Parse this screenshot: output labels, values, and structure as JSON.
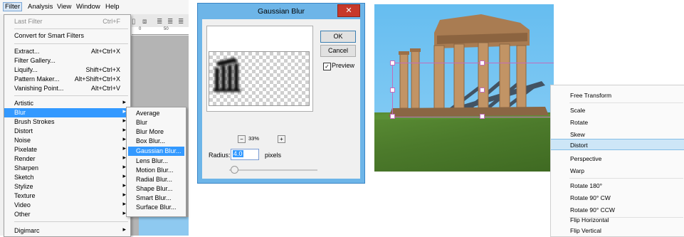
{
  "menubar": {
    "items": [
      "Filter",
      "Analysis",
      "View",
      "Window",
      "Help"
    ]
  },
  "filter_menu": {
    "items": [
      {
        "label": "Last Filter",
        "shortcut": "Ctrl+F",
        "disabled": true
      },
      {
        "label": "Convert for Smart Filters"
      },
      {
        "label": "Extract...",
        "shortcut": "Alt+Ctrl+X"
      },
      {
        "label": "Filter Gallery..."
      },
      {
        "label": "Liquify...",
        "shortcut": "Shift+Ctrl+X"
      },
      {
        "label": "Pattern Maker...",
        "shortcut": "Alt+Shift+Ctrl+X"
      },
      {
        "label": "Vanishing Point...",
        "shortcut": "Alt+Ctrl+V"
      },
      {
        "label": "Artistic"
      },
      {
        "label": "Blur"
      },
      {
        "label": "Brush Strokes"
      },
      {
        "label": "Distort"
      },
      {
        "label": "Noise"
      },
      {
        "label": "Pixelate"
      },
      {
        "label": "Render"
      },
      {
        "label": "Sharpen"
      },
      {
        "label": "Sketch"
      },
      {
        "label": "Stylize"
      },
      {
        "label": "Texture"
      },
      {
        "label": "Video"
      },
      {
        "label": "Other"
      },
      {
        "label": "Digimarc"
      }
    ]
  },
  "blur_submenu": {
    "items": [
      "Average",
      "Blur",
      "Blur More",
      "Box Blur...",
      "Gaussian Blur...",
      "Lens Blur...",
      "Motion Blur...",
      "Radial Blur...",
      "Shape Blur...",
      "Smart Blur...",
      "Surface Blur..."
    ]
  },
  "ruler": {
    "ticks": [
      "0",
      "50"
    ]
  },
  "gaussian_dialog": {
    "title": "Gaussian Blur",
    "close": "✕",
    "ok": "OK",
    "cancel": "Cancel",
    "preview_label": "Preview",
    "preview_checked": "✓",
    "zoom_minus": "−",
    "zoom": "33%",
    "zoom_plus": "+",
    "radius_label": "Radius:",
    "radius_value": "4.0",
    "radius_unit": "pixels"
  },
  "transform_menu": {
    "items": [
      "Free Transform",
      "Scale",
      "Rotate",
      "Skew",
      "Distort",
      "Perspective",
      "Warp",
      "Rotate 180°",
      "Rotate 90° CW",
      "Rotate 90° CCW",
      "Flip Horizontal",
      "Flip Vertical"
    ]
  },
  "colors": {
    "highlight": "#3399ff",
    "sky": "#6bbff0",
    "grass": "#4c7a2b",
    "stone": "#b98a5c",
    "close_button": "#c7392b"
  }
}
